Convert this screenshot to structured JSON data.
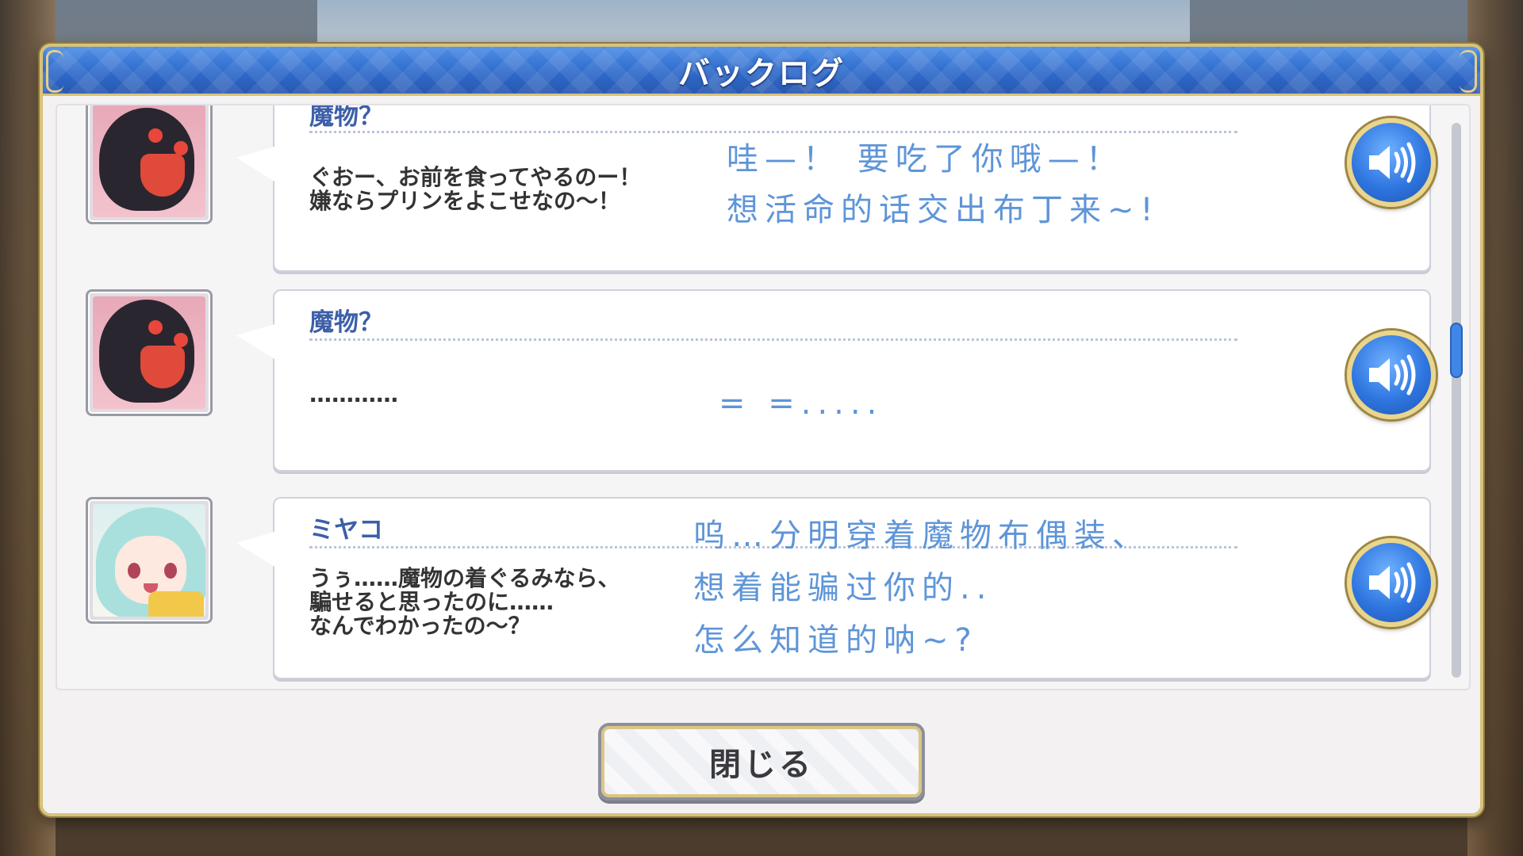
{
  "header": {
    "title": "バックログ"
  },
  "entries": [
    {
      "speaker": "魔物？",
      "text_jp": "ぐおー、お前を食ってやるのー！\n嫌ならプリンをよこせなの〜！",
      "text_cn": "哇—！ 要吃了你哦—！\n想活命的话交出布丁来~!",
      "avatar_icon": "monster-portrait",
      "voice_icon": "speaker-icon"
    },
    {
      "speaker": "魔物？",
      "text_jp": "…………",
      "text_cn": "= =.....",
      "avatar_icon": "monster-portrait",
      "voice_icon": "speaker-icon"
    },
    {
      "speaker": "ミヤコ",
      "text_jp": "うぅ……魔物の着ぐるみなら、\n騙せると思ったのに……\nなんでわかったの〜？",
      "text_cn": "呜…分明穿着魔物布偶装、\n想着能骗过你的..\n怎么知道的呐~?",
      "avatar_icon": "girl-portrait",
      "voice_icon": "speaker-icon"
    }
  ],
  "footer": {
    "close_label": "閉じる"
  },
  "colors": {
    "header_blue": "#2e68c8",
    "gold_border": "#d8c27a",
    "speaker_name": "#3c5fa8",
    "translation_text": "#5e95d8",
    "scroll_thumb": "#3f86e6"
  }
}
